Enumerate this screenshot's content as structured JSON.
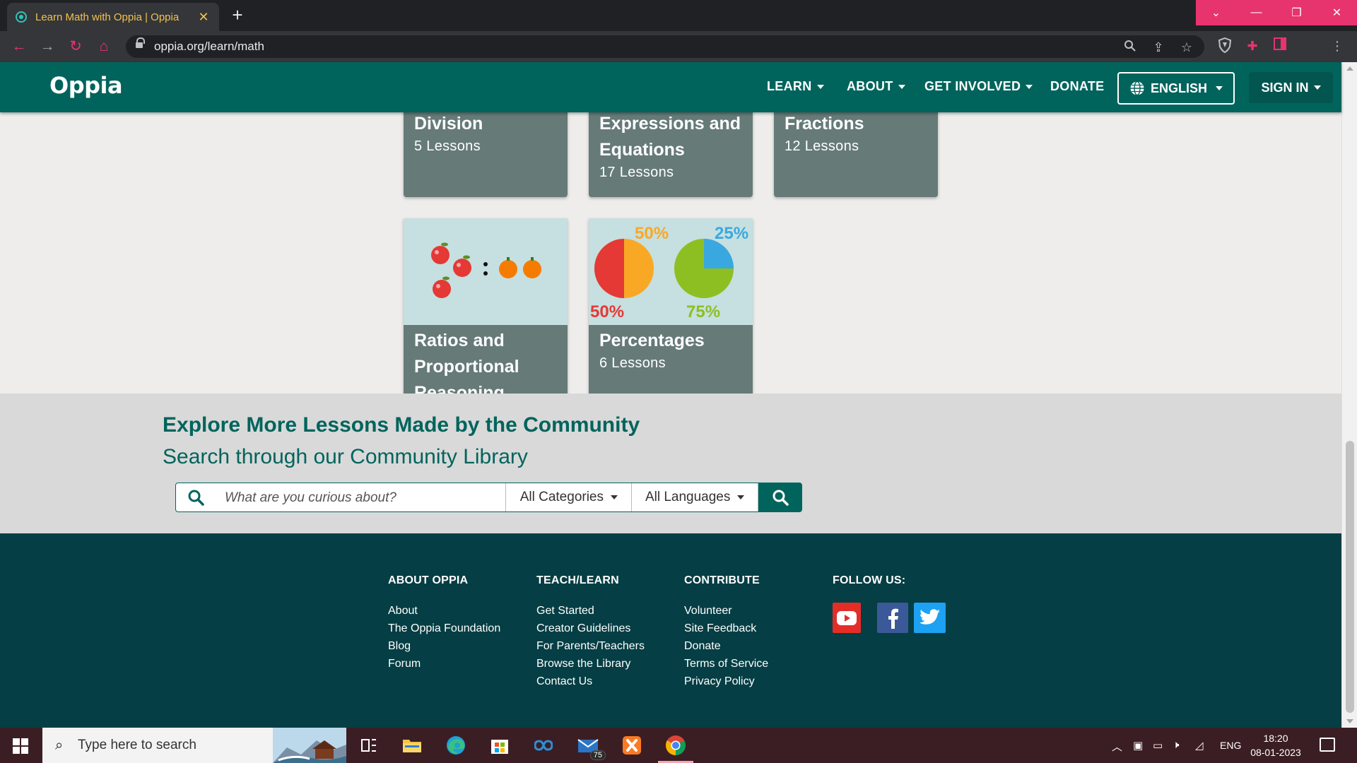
{
  "browser": {
    "tab_title": "Learn Math with Oppia | Oppia",
    "tab_close": "✕",
    "new_tab": "+",
    "url": "oppia.org/learn/math",
    "window_controls": {
      "chevron": "⌄",
      "minimize": "—",
      "restore": "❐",
      "close": "✕"
    }
  },
  "navbar": {
    "logo": "Oppia",
    "items": [
      "LEARN",
      "ABOUT",
      "GET INVOLVED",
      "DONATE"
    ],
    "language": "ENGLISH",
    "sign_in": "SIGN IN",
    "color": "#00645c"
  },
  "lesson_cards": [
    {
      "title": "Division",
      "count": "5 Lessons"
    },
    {
      "title": "Expressions and Equations",
      "count": "17 Lessons"
    },
    {
      "title": "Fractions",
      "count": "12 Lessons"
    },
    {
      "title": "Ratios and Proportional Reasoning",
      "count": ""
    },
    {
      "title": "Percentages",
      "count": "6 Lessons"
    }
  ],
  "percentages_image": {
    "labels": [
      "50%",
      "25%",
      "50%",
      "75%"
    ],
    "pie_left": {
      "fraction": 0.5,
      "colors": [
        "#e53935",
        "#f9a825"
      ]
    },
    "pie_right": {
      "fraction": 0.25,
      "colors": [
        "#3aa8e0",
        "#8dbf23"
      ]
    }
  },
  "community": {
    "heading": "Explore More Lessons Made by the Community",
    "subheading": "Search through our Community Library",
    "search_placeholder": "What are you curious about?",
    "categories": "All Categories",
    "languages": "All Languages"
  },
  "footer": {
    "columns": [
      {
        "heading": "ABOUT OPPIA",
        "links": [
          "About",
          "The Oppia Foundation",
          "Blog",
          "Forum"
        ]
      },
      {
        "heading": "TEACH/LEARN",
        "links": [
          "Get Started",
          "Creator Guidelines",
          "For Parents/Teachers",
          "Browse the Library",
          "Contact Us"
        ]
      },
      {
        "heading": "CONTRIBUTE",
        "links": [
          "Volunteer",
          "Site Feedback",
          "Donate",
          "Terms of Service",
          "Privacy Policy"
        ]
      }
    ],
    "follow_heading": "FOLLOW US:",
    "social": [
      {
        "icon": "youtube-icon",
        "color": "#e52d27"
      },
      {
        "icon": "facebook-icon",
        "color": "#3b5998"
      },
      {
        "icon": "twitter-icon",
        "color": "#1da1f2"
      }
    ]
  },
  "taskbar": {
    "search_text": "Type here to search",
    "mail_badge": "75",
    "language": "ENG",
    "time": "18:20",
    "date": "08-01-2023"
  }
}
